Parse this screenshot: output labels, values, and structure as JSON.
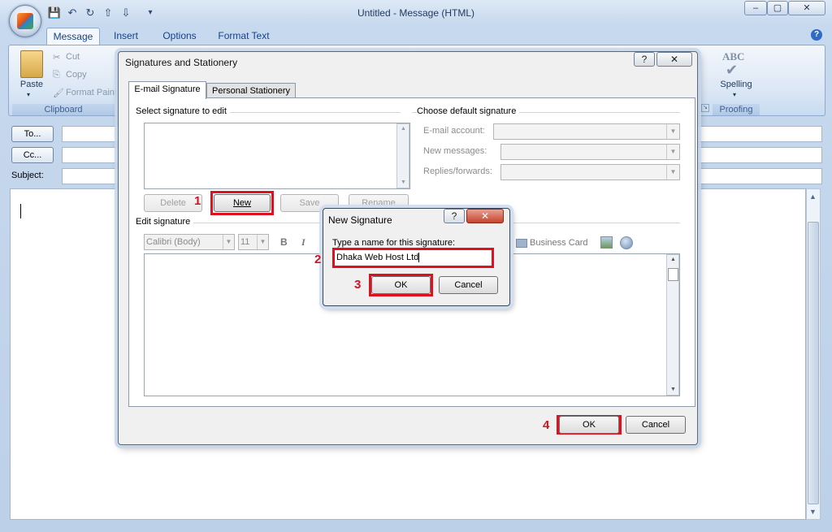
{
  "window": {
    "title": "Untitled - Message (HTML)",
    "controls": [
      "–",
      "▢",
      "✕"
    ]
  },
  "ribbon_tabs": [
    "Message",
    "Insert",
    "Options",
    "Format Text"
  ],
  "clipboard": {
    "paste": "Paste",
    "cut": "Cut",
    "copy": "Copy",
    "format_painter": "Format Painter",
    "group": "Clipboard"
  },
  "proofing": {
    "spelling": "Spelling",
    "group": "Proofing",
    "abc": "ABC"
  },
  "message_fields": {
    "to": "To...",
    "cc": "Cc...",
    "subject": "Subject:"
  },
  "signatures_dialog": {
    "title": "Signatures and Stationery",
    "help": "?",
    "close": "✕",
    "tabs": [
      "E-mail Signature",
      "Personal Stationery"
    ],
    "select_label": "Select signature to edit",
    "default_label": "Choose default signature",
    "email_account": "E-mail account:",
    "new_messages": "New messages:",
    "replies_forwards": "Replies/forwards:",
    "delete": "Delete",
    "new": "New",
    "save": "Save",
    "rename": "Rename",
    "edit_label": "Edit signature",
    "font_name": "Calibri (Body)",
    "font_size": "11",
    "bold": "B",
    "italic": "I",
    "business_card": "Business Card",
    "ok": "OK",
    "cancel": "Cancel"
  },
  "new_signature_dialog": {
    "title": "New Signature",
    "help": "?",
    "close": "✕",
    "prompt": "Type a name for this signature:",
    "name_value": "Dhaka Web Host Ltd",
    "ok": "OK",
    "cancel": "Cancel"
  },
  "steps": [
    "1",
    "2",
    "3",
    "4"
  ],
  "colors": {
    "highlight_red": "#e0101e",
    "step_red": "#d3131f",
    "ribbon_blue": "#15428b"
  }
}
